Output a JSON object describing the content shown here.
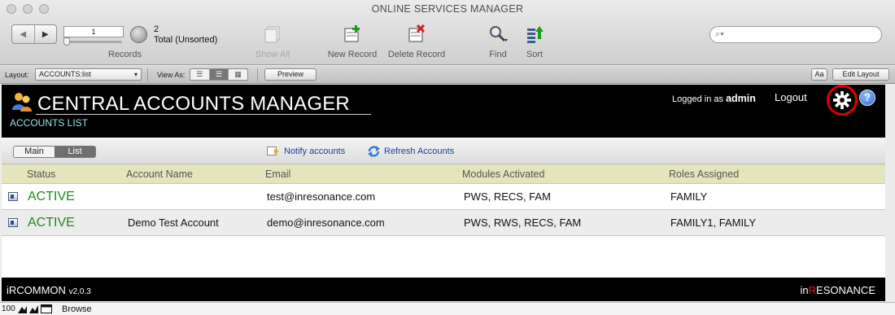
{
  "window": {
    "title": "ONLINE SERVICES MANAGER"
  },
  "toolbar": {
    "record_number": "1",
    "record_count": "2",
    "record_total": "Total (Unsorted)",
    "records_label": "Records",
    "show_all_label": "Show All",
    "new_record_label": "New Record",
    "delete_record_label": "Delete Record",
    "find_label": "Find",
    "sort_label": "Sort"
  },
  "layout_bar": {
    "layout_label": "Layout:",
    "layout_value": "ACCOUNTS:list",
    "view_as_label": "View As:",
    "preview_label": "Preview",
    "font_toggle_label": "Aa",
    "edit_layout_label": "Edit Layout"
  },
  "header": {
    "app_title": "CENTRAL ACCOUNTS MANAGER",
    "subtitle": "ACCOUNTS LIST",
    "logged_in_prefix": "Logged in as",
    "username": "admin",
    "logout_label": "Logout"
  },
  "tabs": {
    "main_label": "Main",
    "list_label": "List"
  },
  "actions": {
    "notify_label": "Notify accounts",
    "refresh_label": "Refresh Accounts"
  },
  "table": {
    "columns": [
      "Status",
      "Account Name",
      "Email",
      "Modules Activated",
      "Roles Assigned"
    ],
    "rows": [
      {
        "status": "ACTIVE",
        "name": "",
        "email": "test@inresonance.com",
        "modules": "PWS, RECS, FAM",
        "roles": "FAMILY"
      },
      {
        "status": "ACTIVE",
        "name": "Demo Test Account",
        "email": "demo@inresonance.com",
        "modules": "PWS, RWS, RECS, FAM",
        "roles": "FAMILY1, FAMILY"
      }
    ]
  },
  "footer": {
    "product": "iRCOMMON",
    "version": "v2.0.3",
    "brand_prefix": "in",
    "brand_red": "R",
    "brand_suffix": "ESONANCE"
  },
  "status_bar": {
    "zoom": "100",
    "mode": "Browse"
  },
  "colors": {
    "active_status": "#1f8a1f",
    "header_bg": "#000000",
    "subtitle": "#8fe4ee",
    "table_header_bg": "#e5e5bd",
    "highlight_ring": "#e30000",
    "link": "#1c3f9a"
  },
  "icons": [
    "record-nav-icon",
    "show-all-icon",
    "new-record-icon",
    "delete-record-icon",
    "find-icon",
    "sort-icon",
    "search-icon",
    "users-icon",
    "gear-icon",
    "help-icon",
    "notify-icon",
    "refresh-icon",
    "record-icon"
  ]
}
